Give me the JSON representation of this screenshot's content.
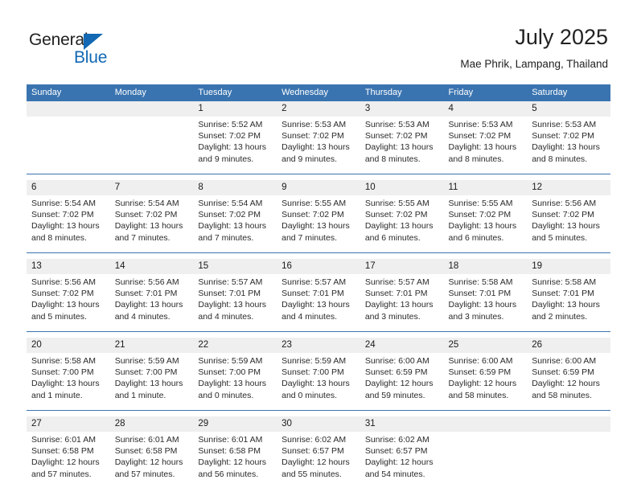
{
  "brand": {
    "name_part1": "General",
    "name_part2": "Blue",
    "triangle_color": "#1268b3"
  },
  "header": {
    "title": "July 2025",
    "subtitle": "Mae Phrik, Lampang, Thailand",
    "accent_color": "#3a74b0",
    "date_strip_color": "#efefef"
  },
  "weekdays": [
    "Sunday",
    "Monday",
    "Tuesday",
    "Wednesday",
    "Thursday",
    "Friday",
    "Saturday"
  ],
  "weeks": [
    [
      {
        "day": "",
        "sunrise": "",
        "sunset": "",
        "daylight1": "",
        "daylight2": ""
      },
      {
        "day": "",
        "sunrise": "",
        "sunset": "",
        "daylight1": "",
        "daylight2": ""
      },
      {
        "day": "1",
        "sunrise": "Sunrise: 5:52 AM",
        "sunset": "Sunset: 7:02 PM",
        "daylight1": "Daylight: 13 hours",
        "daylight2": "and 9 minutes."
      },
      {
        "day": "2",
        "sunrise": "Sunrise: 5:53 AM",
        "sunset": "Sunset: 7:02 PM",
        "daylight1": "Daylight: 13 hours",
        "daylight2": "and 9 minutes."
      },
      {
        "day": "3",
        "sunrise": "Sunrise: 5:53 AM",
        "sunset": "Sunset: 7:02 PM",
        "daylight1": "Daylight: 13 hours",
        "daylight2": "and 8 minutes."
      },
      {
        "day": "4",
        "sunrise": "Sunrise: 5:53 AM",
        "sunset": "Sunset: 7:02 PM",
        "daylight1": "Daylight: 13 hours",
        "daylight2": "and 8 minutes."
      },
      {
        "day": "5",
        "sunrise": "Sunrise: 5:53 AM",
        "sunset": "Sunset: 7:02 PM",
        "daylight1": "Daylight: 13 hours",
        "daylight2": "and 8 minutes."
      }
    ],
    [
      {
        "day": "6",
        "sunrise": "Sunrise: 5:54 AM",
        "sunset": "Sunset: 7:02 PM",
        "daylight1": "Daylight: 13 hours",
        "daylight2": "and 8 minutes."
      },
      {
        "day": "7",
        "sunrise": "Sunrise: 5:54 AM",
        "sunset": "Sunset: 7:02 PM",
        "daylight1": "Daylight: 13 hours",
        "daylight2": "and 7 minutes."
      },
      {
        "day": "8",
        "sunrise": "Sunrise: 5:54 AM",
        "sunset": "Sunset: 7:02 PM",
        "daylight1": "Daylight: 13 hours",
        "daylight2": "and 7 minutes."
      },
      {
        "day": "9",
        "sunrise": "Sunrise: 5:55 AM",
        "sunset": "Sunset: 7:02 PM",
        "daylight1": "Daylight: 13 hours",
        "daylight2": "and 7 minutes."
      },
      {
        "day": "10",
        "sunrise": "Sunrise: 5:55 AM",
        "sunset": "Sunset: 7:02 PM",
        "daylight1": "Daylight: 13 hours",
        "daylight2": "and 6 minutes."
      },
      {
        "day": "11",
        "sunrise": "Sunrise: 5:55 AM",
        "sunset": "Sunset: 7:02 PM",
        "daylight1": "Daylight: 13 hours",
        "daylight2": "and 6 minutes."
      },
      {
        "day": "12",
        "sunrise": "Sunrise: 5:56 AM",
        "sunset": "Sunset: 7:02 PM",
        "daylight1": "Daylight: 13 hours",
        "daylight2": "and 5 minutes."
      }
    ],
    [
      {
        "day": "13",
        "sunrise": "Sunrise: 5:56 AM",
        "sunset": "Sunset: 7:02 PM",
        "daylight1": "Daylight: 13 hours",
        "daylight2": "and 5 minutes."
      },
      {
        "day": "14",
        "sunrise": "Sunrise: 5:56 AM",
        "sunset": "Sunset: 7:01 PM",
        "daylight1": "Daylight: 13 hours",
        "daylight2": "and 4 minutes."
      },
      {
        "day": "15",
        "sunrise": "Sunrise: 5:57 AM",
        "sunset": "Sunset: 7:01 PM",
        "daylight1": "Daylight: 13 hours",
        "daylight2": "and 4 minutes."
      },
      {
        "day": "16",
        "sunrise": "Sunrise: 5:57 AM",
        "sunset": "Sunset: 7:01 PM",
        "daylight1": "Daylight: 13 hours",
        "daylight2": "and 4 minutes."
      },
      {
        "day": "17",
        "sunrise": "Sunrise: 5:57 AM",
        "sunset": "Sunset: 7:01 PM",
        "daylight1": "Daylight: 13 hours",
        "daylight2": "and 3 minutes."
      },
      {
        "day": "18",
        "sunrise": "Sunrise: 5:58 AM",
        "sunset": "Sunset: 7:01 PM",
        "daylight1": "Daylight: 13 hours",
        "daylight2": "and 3 minutes."
      },
      {
        "day": "19",
        "sunrise": "Sunrise: 5:58 AM",
        "sunset": "Sunset: 7:01 PM",
        "daylight1": "Daylight: 13 hours",
        "daylight2": "and 2 minutes."
      }
    ],
    [
      {
        "day": "20",
        "sunrise": "Sunrise: 5:58 AM",
        "sunset": "Sunset: 7:00 PM",
        "daylight1": "Daylight: 13 hours",
        "daylight2": "and 1 minute."
      },
      {
        "day": "21",
        "sunrise": "Sunrise: 5:59 AM",
        "sunset": "Sunset: 7:00 PM",
        "daylight1": "Daylight: 13 hours",
        "daylight2": "and 1 minute."
      },
      {
        "day": "22",
        "sunrise": "Sunrise: 5:59 AM",
        "sunset": "Sunset: 7:00 PM",
        "daylight1": "Daylight: 13 hours",
        "daylight2": "and 0 minutes."
      },
      {
        "day": "23",
        "sunrise": "Sunrise: 5:59 AM",
        "sunset": "Sunset: 7:00 PM",
        "daylight1": "Daylight: 13 hours",
        "daylight2": "and 0 minutes."
      },
      {
        "day": "24",
        "sunrise": "Sunrise: 6:00 AM",
        "sunset": "Sunset: 6:59 PM",
        "daylight1": "Daylight: 12 hours",
        "daylight2": "and 59 minutes."
      },
      {
        "day": "25",
        "sunrise": "Sunrise: 6:00 AM",
        "sunset": "Sunset: 6:59 PM",
        "daylight1": "Daylight: 12 hours",
        "daylight2": "and 58 minutes."
      },
      {
        "day": "26",
        "sunrise": "Sunrise: 6:00 AM",
        "sunset": "Sunset: 6:59 PM",
        "daylight1": "Daylight: 12 hours",
        "daylight2": "and 58 minutes."
      }
    ],
    [
      {
        "day": "27",
        "sunrise": "Sunrise: 6:01 AM",
        "sunset": "Sunset: 6:58 PM",
        "daylight1": "Daylight: 12 hours",
        "daylight2": "and 57 minutes."
      },
      {
        "day": "28",
        "sunrise": "Sunrise: 6:01 AM",
        "sunset": "Sunset: 6:58 PM",
        "daylight1": "Daylight: 12 hours",
        "daylight2": "and 57 minutes."
      },
      {
        "day": "29",
        "sunrise": "Sunrise: 6:01 AM",
        "sunset": "Sunset: 6:58 PM",
        "daylight1": "Daylight: 12 hours",
        "daylight2": "and 56 minutes."
      },
      {
        "day": "30",
        "sunrise": "Sunrise: 6:02 AM",
        "sunset": "Sunset: 6:57 PM",
        "daylight1": "Daylight: 12 hours",
        "daylight2": "and 55 minutes."
      },
      {
        "day": "31",
        "sunrise": "Sunrise: 6:02 AM",
        "sunset": "Sunset: 6:57 PM",
        "daylight1": "Daylight: 12 hours",
        "daylight2": "and 54 minutes."
      },
      {
        "day": "",
        "sunrise": "",
        "sunset": "",
        "daylight1": "",
        "daylight2": ""
      },
      {
        "day": "",
        "sunrise": "",
        "sunset": "",
        "daylight1": "",
        "daylight2": ""
      }
    ]
  ]
}
